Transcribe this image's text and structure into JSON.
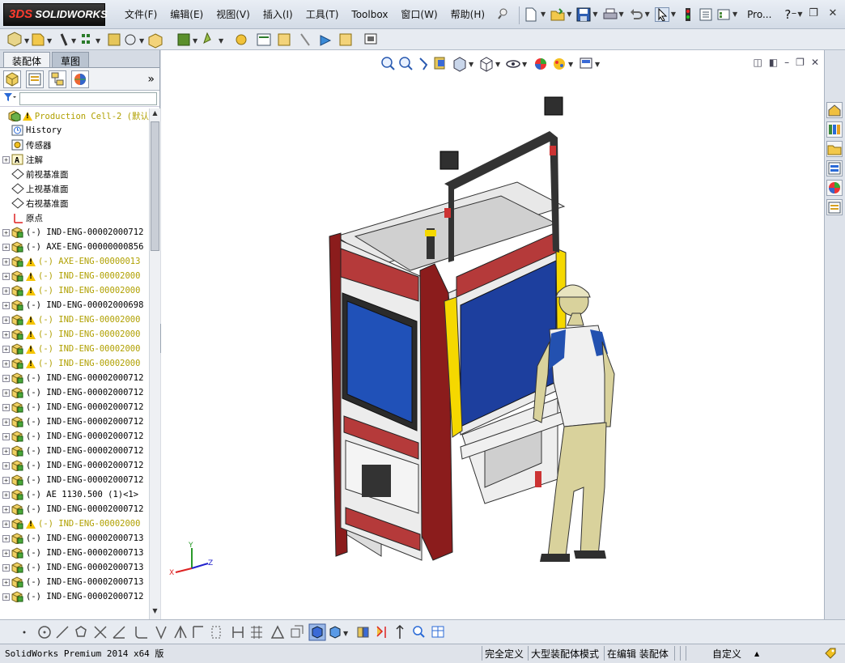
{
  "app": {
    "logo_text": "SOLIDWORKS",
    "logo_mark": "3DS"
  },
  "menu": [
    "文件(F)",
    "编辑(E)",
    "视图(V)",
    "插入(I)",
    "工具(T)",
    "Toolbox",
    "窗口(W)",
    "帮助(H)"
  ],
  "search": {
    "label": "Pro..."
  },
  "panel": {
    "tabs": [
      {
        "label": "装配体"
      },
      {
        "label": "草图"
      }
    ],
    "tree": [
      {
        "label": "Production Cell-2  (默认",
        "icon": "assembly-icon",
        "warn": true,
        "yellow": true,
        "plus": false
      },
      {
        "label": "History",
        "icon": "history-icon",
        "warn": false,
        "yellow": false,
        "plus": false
      },
      {
        "label": "传感器",
        "icon": "sensor-icon",
        "warn": false,
        "yellow": false,
        "plus": false
      },
      {
        "label": "注解",
        "icon": "annotation-icon",
        "warn": false,
        "yellow": false,
        "plus": true
      },
      {
        "label": "前视基准面",
        "icon": "plane-icon",
        "warn": false,
        "yellow": false,
        "plus": false
      },
      {
        "label": "上视基准面",
        "icon": "plane-icon",
        "warn": false,
        "yellow": false,
        "plus": false
      },
      {
        "label": "右视基准面",
        "icon": "plane-icon",
        "warn": false,
        "yellow": false,
        "plus": false
      },
      {
        "label": "原点",
        "icon": "origin-icon",
        "warn": false,
        "yellow": false,
        "plus": false
      },
      {
        "label": "(-) IND-ENG-00002000712",
        "icon": "part-icon",
        "warn": false,
        "yellow": false,
        "plus": true
      },
      {
        "label": "(-) AXE-ENG-00000000856",
        "icon": "part-icon",
        "warn": false,
        "yellow": false,
        "plus": true
      },
      {
        "label": "(-) AXE-ENG-00000013",
        "icon": "part-icon",
        "warn": true,
        "yellow": true,
        "plus": true
      },
      {
        "label": "(-) IND-ENG-00002000",
        "icon": "part-icon",
        "warn": true,
        "yellow": true,
        "plus": true
      },
      {
        "label": "(-) IND-ENG-00002000",
        "icon": "part-icon",
        "warn": true,
        "yellow": true,
        "plus": true
      },
      {
        "label": "(-) IND-ENG-00002000698",
        "icon": "part-icon",
        "warn": false,
        "yellow": false,
        "plus": true
      },
      {
        "label": "(-) IND-ENG-00002000",
        "icon": "part-icon",
        "warn": true,
        "yellow": true,
        "plus": true
      },
      {
        "label": "(-) IND-ENG-00002000",
        "icon": "part-icon",
        "warn": true,
        "yellow": true,
        "plus": true
      },
      {
        "label": "(-) IND-ENG-00002000",
        "icon": "part-icon",
        "warn": true,
        "yellow": true,
        "plus": true
      },
      {
        "label": "(-) IND-ENG-00002000",
        "icon": "part-icon",
        "warn": true,
        "yellow": true,
        "plus": true
      },
      {
        "label": "(-) IND-ENG-00002000712",
        "icon": "part-icon",
        "warn": false,
        "yellow": false,
        "plus": true
      },
      {
        "label": "(-) IND-ENG-00002000712",
        "icon": "part-icon",
        "warn": false,
        "yellow": false,
        "plus": true
      },
      {
        "label": "(-) IND-ENG-00002000712",
        "icon": "part-icon",
        "warn": false,
        "yellow": false,
        "plus": true
      },
      {
        "label": "(-) IND-ENG-00002000712",
        "icon": "part-icon",
        "warn": false,
        "yellow": false,
        "plus": true
      },
      {
        "label": "(-) IND-ENG-00002000712",
        "icon": "part-icon",
        "warn": false,
        "yellow": false,
        "plus": true
      },
      {
        "label": "(-) IND-ENG-00002000712",
        "icon": "part-icon",
        "warn": false,
        "yellow": false,
        "plus": true
      },
      {
        "label": "(-) IND-ENG-00002000712",
        "icon": "part-icon",
        "warn": false,
        "yellow": false,
        "plus": true
      },
      {
        "label": "(-) IND-ENG-00002000712",
        "icon": "part-icon",
        "warn": false,
        "yellow": false,
        "plus": true
      },
      {
        "label": "(-) AE 1130.500  (1)<1>",
        "icon": "part-icon",
        "warn": false,
        "yellow": false,
        "plus": true
      },
      {
        "label": "(-) IND-ENG-00002000712",
        "icon": "part-icon",
        "warn": false,
        "yellow": false,
        "plus": true
      },
      {
        "label": "(-) IND-ENG-00002000",
        "icon": "part-icon",
        "warn": true,
        "yellow": true,
        "plus": true
      },
      {
        "label": "(-) IND-ENG-00002000713",
        "icon": "part-icon",
        "warn": false,
        "yellow": false,
        "plus": true
      },
      {
        "label": "(-) IND-ENG-00002000713",
        "icon": "part-icon",
        "warn": false,
        "yellow": false,
        "plus": true
      },
      {
        "label": "(-) IND-ENG-00002000713",
        "icon": "part-icon",
        "warn": false,
        "yellow": false,
        "plus": true
      },
      {
        "label": "(-) IND-ENG-00002000713",
        "icon": "part-icon",
        "warn": false,
        "yellow": false,
        "plus": true
      },
      {
        "label": "(-) IND-ENG-00002000712",
        "icon": "part-icon",
        "warn": false,
        "yellow": false,
        "plus": true
      }
    ]
  },
  "status": {
    "version": "SolidWorks Premium 2014 x64 版",
    "fully_defined": "完全定义",
    "mode": "大型装配体模式",
    "editing": "在编辑 装配体",
    "custom": "自定义"
  },
  "colors": {
    "frame_red": "#8b1c1c",
    "panel_blue": "#1d3f9e",
    "accent_yellow": "#f5d800"
  }
}
